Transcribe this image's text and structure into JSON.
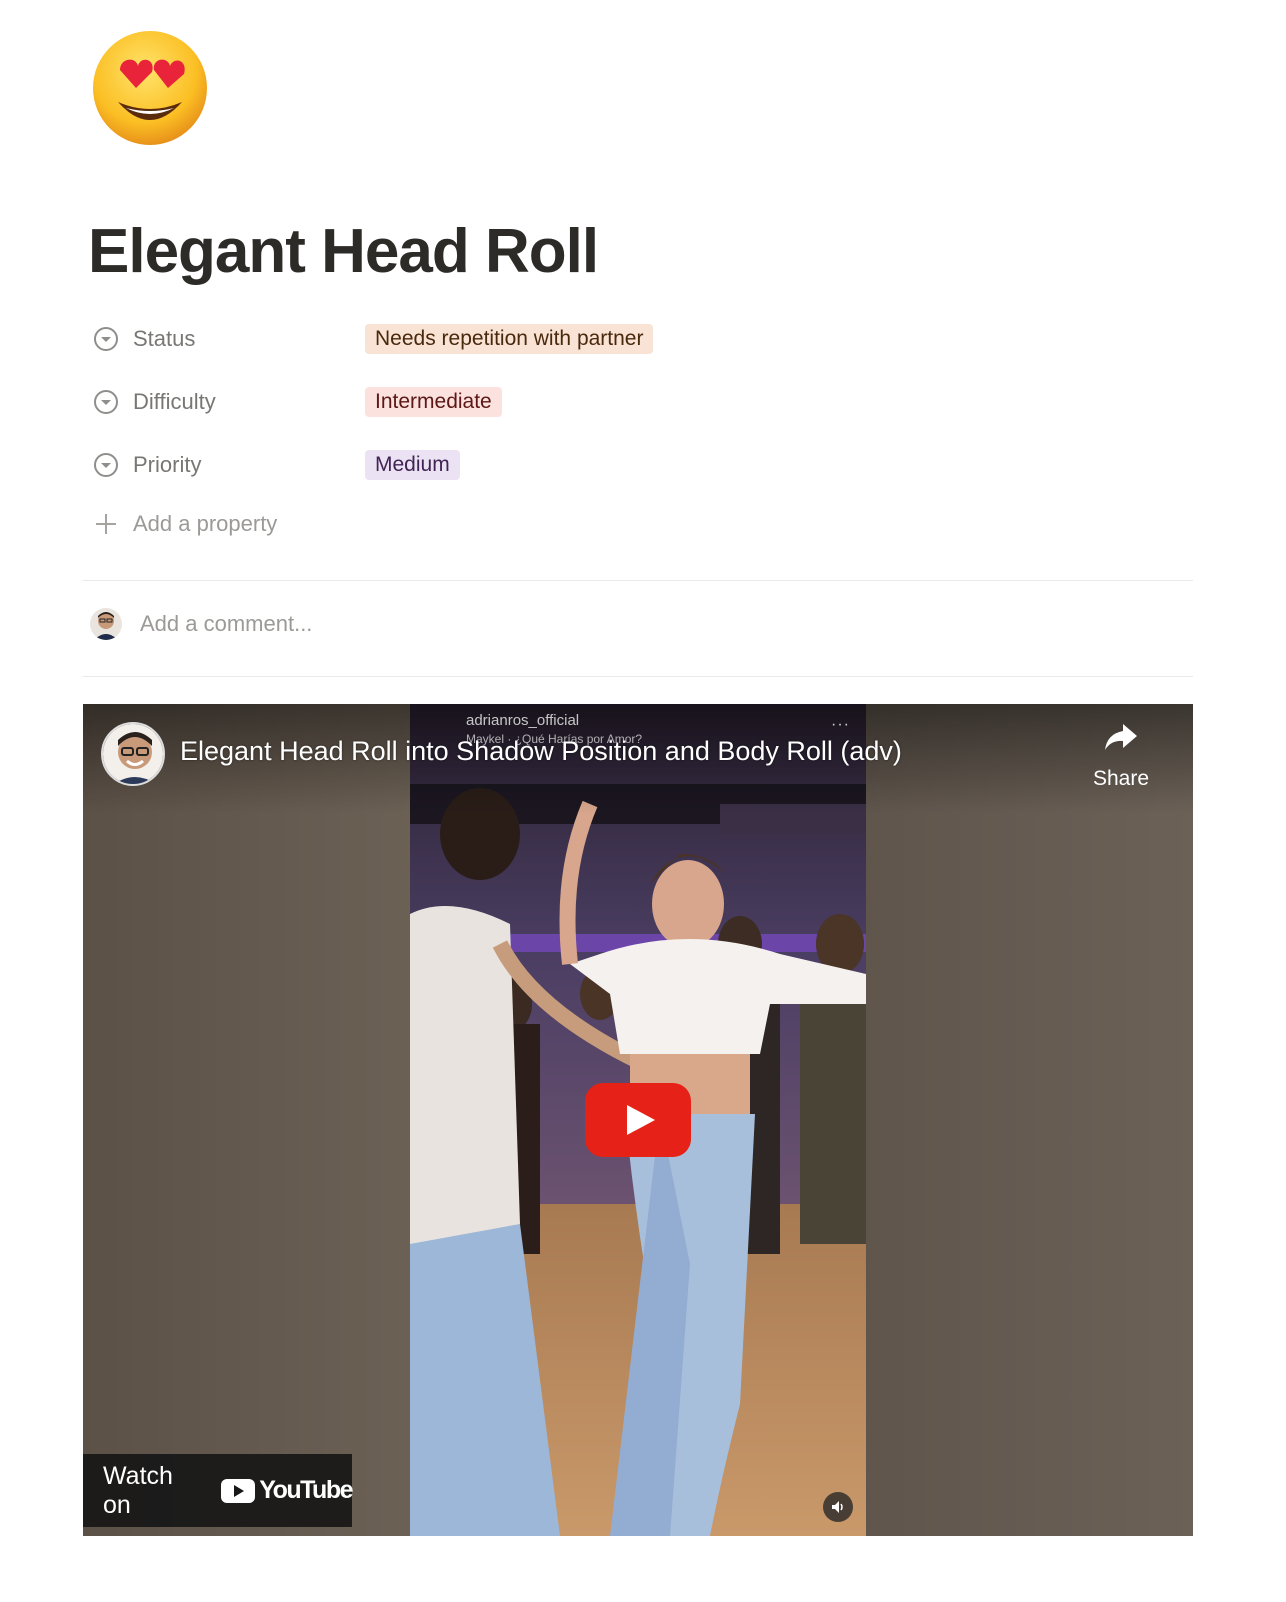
{
  "page": {
    "icon": "smiling-face-with-heart-eyes-emoji",
    "title": "Elegant Head Roll"
  },
  "properties": [
    {
      "name": "Status",
      "icon": "select-chevron-icon",
      "value": "Needs repetition with partner",
      "color": "#f9e3d4"
    },
    {
      "name": "Difficulty",
      "icon": "select-chevron-icon",
      "value": "Intermediate",
      "color": "#fbe2df"
    },
    {
      "name": "Priority",
      "icon": "select-chevron-icon",
      "value": "Medium",
      "color": "#ebe3f3"
    }
  ],
  "add_property_label": "Add a property",
  "comment": {
    "placeholder": "Add a comment..."
  },
  "video": {
    "title": "Elegant Head Roll into Shadow Position and Body Roll (adv)",
    "overlay_user": "adrianros_official",
    "overlay_song": "Maykel · ¿Qué Harías por Amor?",
    "overlay_more": "···",
    "share_label": "Share",
    "watch_on_label": "Watch on",
    "youtube_label": "YouTube",
    "play_color": "#e62117"
  }
}
